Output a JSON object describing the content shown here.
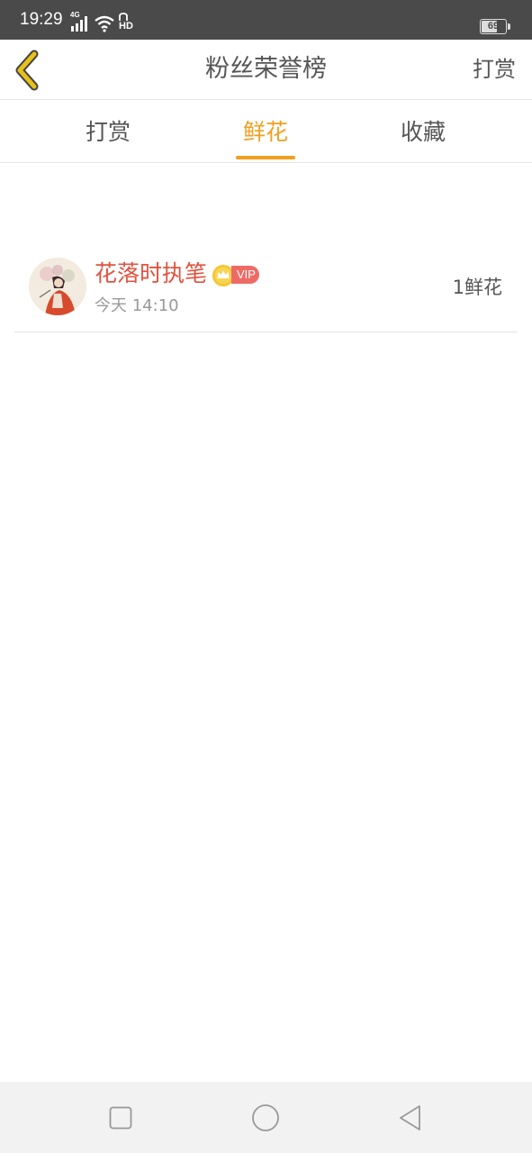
{
  "status_bar": {
    "time": "19:29",
    "network": "4G",
    "hd": "HD",
    "battery_level": "69",
    "battery_fraction": 0.69
  },
  "header": {
    "title": "粉丝荣誉榜",
    "action_label": "打赏",
    "back_icon": "chevron-left-icon",
    "back_icon_color": "#e8c01a"
  },
  "tabs": [
    {
      "label": "打赏",
      "active": false
    },
    {
      "label": "鲜花",
      "active": true
    },
    {
      "label": "收藏",
      "active": false
    }
  ],
  "colors": {
    "accent": "#f0a020",
    "username": "#e0533e",
    "vip_badge": "#ee6b65"
  },
  "list": [
    {
      "name": "花落时执笔",
      "badge": "VIP",
      "time": "今天 14:10",
      "amount": "1鲜花"
    }
  ],
  "nav_bar": {
    "recent_icon": "square-icon",
    "home_icon": "circle-icon",
    "back_icon": "triangle-back-icon"
  }
}
